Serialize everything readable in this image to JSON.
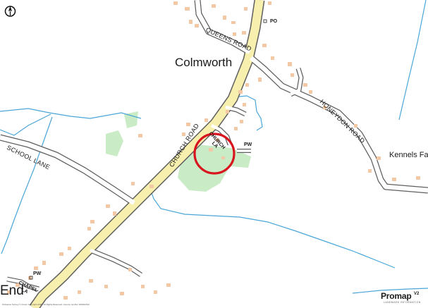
{
  "place_labels": {
    "colmworth": "Colmworth",
    "end": "End",
    "kennels": "Kennels Fa"
  },
  "road_labels": {
    "queens_road": "QUEENS ROAD",
    "honeydon_road": "HONEYDON ROAD",
    "church_road": "CHURCH ROAD",
    "school_lane": "SCHOOL LANE",
    "church_la_1": "CHURCH",
    "church_la_2": "LA",
    "chapel_la_1": "CHAPEL",
    "chapel_la_2": "LA"
  },
  "poi_labels": {
    "po": "PO",
    "pw_church": "PW",
    "pw_chapel": "PW"
  },
  "compass": {
    "icon": "north-arrow-icon"
  },
  "branding": {
    "logo_main": "Promap",
    "logo_version": "V2",
    "logo_sub": "LANDMARK INFORMATION"
  },
  "copyright": "Ordnance Survey © Crown Copyright 2025. All Rights Reserved. Licence number 100022432",
  "colors": {
    "road_fill": "#f7efae",
    "road_edge": "#5f5f5f",
    "minor_road_fill": "#ffffff",
    "building": "#f3c8a4",
    "water": "#4aa6d8",
    "woodland": "#c9ecc6",
    "site_marker": "#d8141f"
  }
}
